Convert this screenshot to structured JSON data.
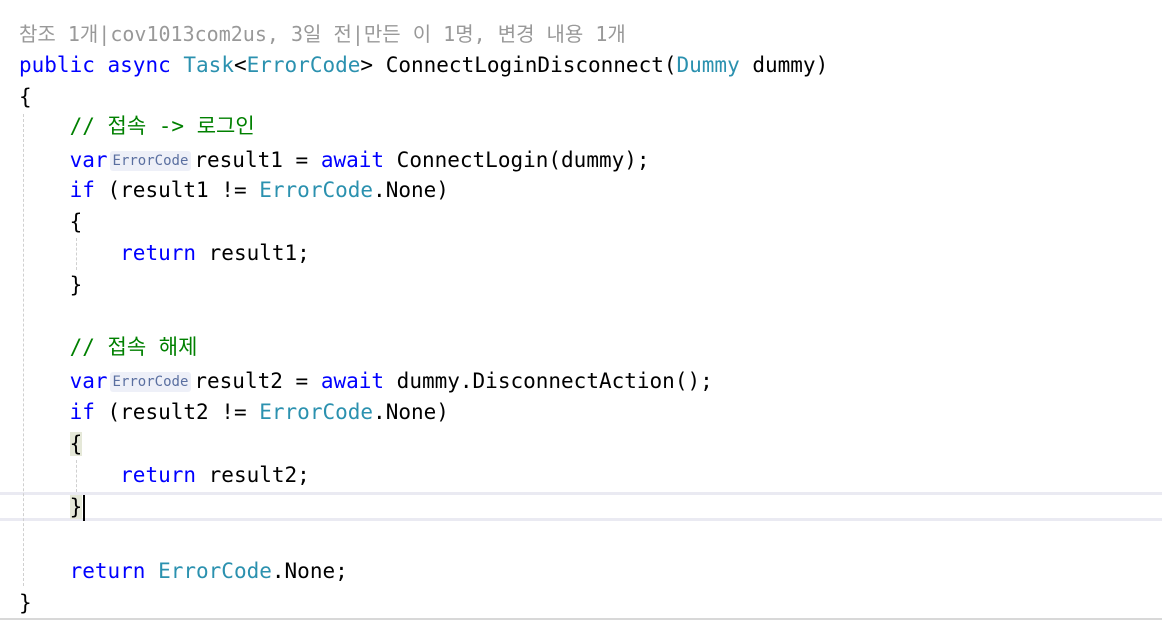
{
  "codelens": {
    "references": "참조 1개",
    "author_date": "cov1013com2us, 3일 전",
    "authors": "만든 이 1명, 변경 내용 1개"
  },
  "code": {
    "sig_public": "public",
    "sig_async": "async",
    "sig_task": "Task",
    "sig_lt": "<",
    "sig_errorcode": "ErrorCode",
    "sig_gt_name": "> ConnectLoginDisconnect(",
    "sig_param_type": "Dummy",
    "sig_param_name": " dummy)",
    "open_brace": "{",
    "comment1": "// 접속 -> 로그인",
    "var_kw": "var",
    "hint_type": "ErrorCode",
    "l1_rest_a": "result1 = ",
    "await_kw": "await",
    "l1_rest_b": " ConnectLogin(dummy);",
    "if_kw": "if",
    "if1_a": " (result1 != ",
    "errorcode": "ErrorCode",
    "if_none": ".None)",
    "inner_open": "{",
    "return_kw": "return",
    "ret1_val": " result1;",
    "inner_close": "}",
    "comment2": "// 접속 해제",
    "l2_rest_a": "result2 = ",
    "l2_rest_b": " dummy.DisconnectAction();",
    "if2_a": " (result2 != ",
    "ret2_val": " result2;",
    "final_none": ".None;",
    "close_brace": "}"
  },
  "colors": {
    "keyword": "#0000ff",
    "type": "#2b91af",
    "comment": "#008000",
    "codelens": "#999999",
    "hint_bg": "#eef0f8"
  }
}
